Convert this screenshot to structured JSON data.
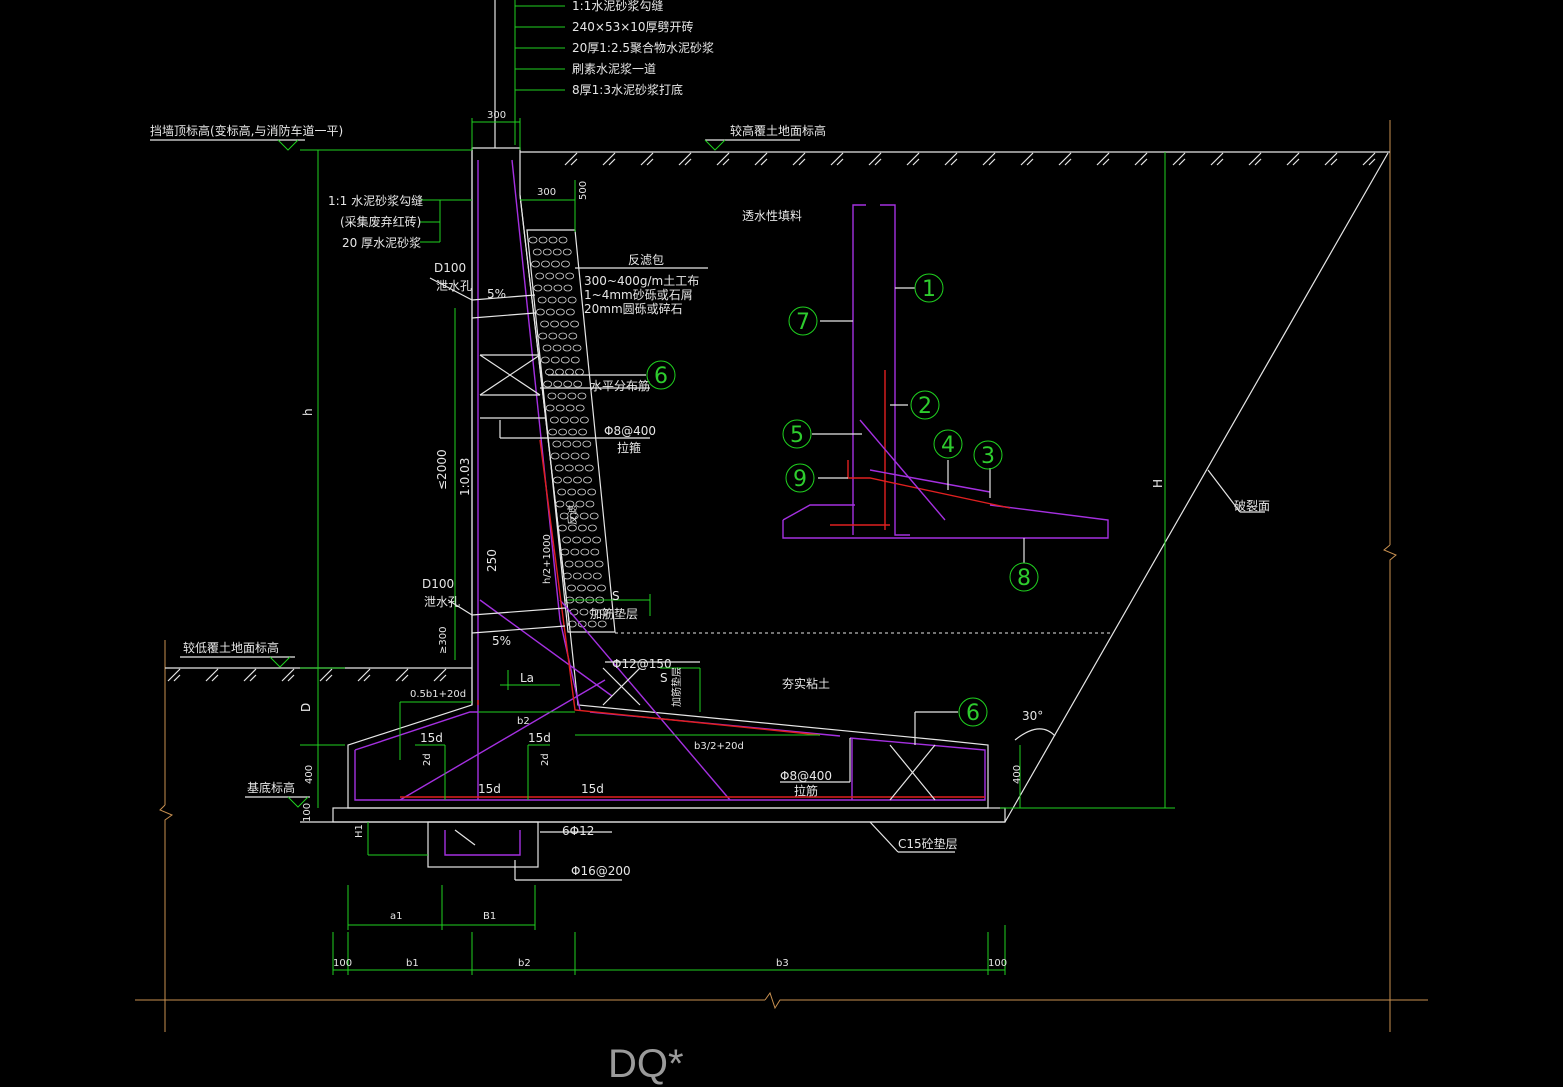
{
  "title": "DQ*",
  "colors": {
    "background": "#000000",
    "outline": "#e6e6e6",
    "dimension": "#1fd01f",
    "rebar_main": "#a430e0",
    "rebar_secondary": "#e02020",
    "text": "#e6e6e6",
    "ground": "#c89050"
  },
  "layers": [
    {
      "text": "1:1水泥砂浆勾缝"
    },
    {
      "text": "240×53×10厚劈开砖"
    },
    {
      "text": "20厚1:2.5聚合物水泥砂浆"
    },
    {
      "text": "刷素水泥浆一道"
    },
    {
      "text": "8厚1:3水泥砂浆打底"
    }
  ],
  "levels": {
    "wall_top": "挡墙顶标高(变标高,与消防车道一平)",
    "high_ground": "较高覆土地面标高",
    "low_ground": "较低覆土地面标高",
    "base": "基底标高"
  },
  "face_finish": [
    "1:1  水泥砂浆勾缝",
    "(采集废弃红砖)",
    "20  厚水泥砂浆"
  ],
  "drain": {
    "label": "D100",
    "sub": "泄水孔",
    "slope": "5%",
    "filter_title": "反滤包",
    "filter_lines": [
      "300~400g/m土工布",
      "1~4mm砂砾或石屑",
      "20mm圆砾或碎石"
    ],
    "distributed_bar": "水平分布筋",
    "tie_bar": "Φ8@400",
    "tie_label": "拉箍",
    "bottom_layer": "加筋垫层"
  },
  "soils": {
    "fill": "透水性填料",
    "clay": "夯实粘土",
    "slope_face": "破裂面"
  },
  "dims": {
    "wall_top_w": "300",
    "dim_300": "300",
    "dim_500": "500",
    "h": "h",
    "H": "H",
    "D": "D",
    "le2000": "≤2000",
    "ratio": "1:0.03",
    "ge300": "≥300",
    "d250": "250",
    "h2": "h/2+1000",
    "fb": "反滤",
    "s": "S",
    "s2": "S",
    "stiff": "加筋垫层",
    "la": "La",
    "half_b1": "0.5b1+20d",
    "b2": "b2",
    "b3half": "b3/2+20d",
    "d15": "15d",
    "d2": "2d",
    "d400": "400",
    "d100": "100",
    "h1": "H1",
    "a1": "a1",
    "B1": "B1",
    "b1": "b1",
    "b3": "b3",
    "angle": "30°"
  },
  "rebar_labels": {
    "phi12_150": "Φ12@150",
    "phi8_400": "Φ8@400",
    "tie": "拉筋",
    "phi12_6": "6Φ12",
    "phi16_200": "Φ16@200",
    "cushion": "C15砼垫层"
  },
  "callouts": [
    "1",
    "2",
    "3",
    "4",
    "5",
    "6",
    "7",
    "8",
    "9"
  ]
}
